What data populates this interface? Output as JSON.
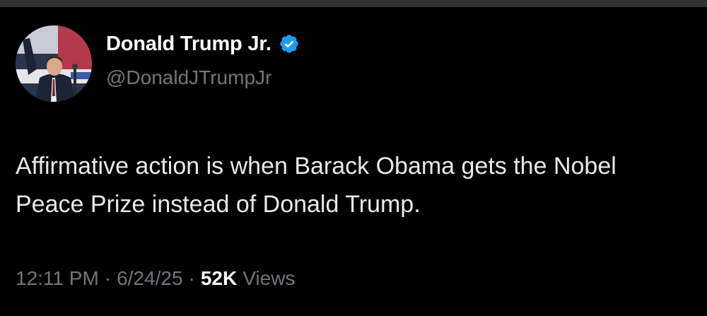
{
  "tweet": {
    "display_name": "Donald Trump Jr.",
    "verified_icon": "verified-badge-icon",
    "handle": "@DonaldJTrumpJr",
    "text": "Affirmative action is when Barack Obama gets the Nobel Peace Prize instead of Donald Trump.",
    "time": "12:11 PM",
    "separator": "·",
    "date": "6/24/25",
    "views_count": "52K",
    "views_label": "Views"
  },
  "colors": {
    "background": "#000000",
    "top_bar": "#2f3336",
    "primary_text": "#e7e9ea",
    "secondary_text": "#71767b",
    "verified_blue": "#1d9bf0"
  }
}
